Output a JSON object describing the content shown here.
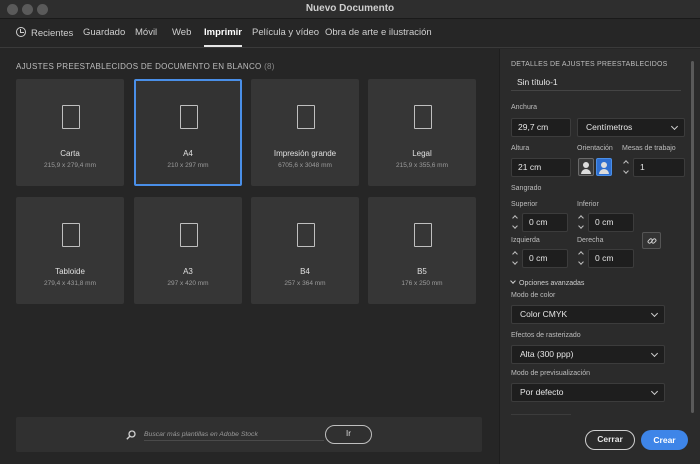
{
  "window": {
    "title": "Nuevo Documento"
  },
  "tabs": [
    {
      "label": "Recientes",
      "icon": "clock-icon"
    },
    {
      "label": "Guardado"
    },
    {
      "label": "Móvil"
    },
    {
      "label": "Web"
    },
    {
      "label": "Imprimir",
      "active": true
    },
    {
      "label": "Película y vídeo"
    },
    {
      "label": "Obra de arte e ilustración"
    }
  ],
  "presets": {
    "title": "AJUSTES PREESTABLECIDOS DE DOCUMENTO EN BLANCO",
    "count": "(8)",
    "items": [
      {
        "name": "Carta",
        "size": "215,9 x 279,4 mm"
      },
      {
        "name": "A4",
        "size": "210 x 297 mm",
        "selected": true
      },
      {
        "name": "Impresión grande",
        "size": "6705,6 x 3048 mm"
      },
      {
        "name": "Legal",
        "size": "215,9 x 355,6 mm"
      },
      {
        "name": "Tabloide",
        "size": "279,4 x 431,8 mm"
      },
      {
        "name": "A3",
        "size": "297 x 420 mm"
      },
      {
        "name": "B4",
        "size": "257 x 364 mm"
      },
      {
        "name": "B5",
        "size": "176 x 250 mm"
      }
    ]
  },
  "search": {
    "placeholder": "Buscar más plantillas en Adobe Stock",
    "go_label": "Ir"
  },
  "details": {
    "heading": "DETALLES DE AJUSTES PREESTABLECIDOS",
    "doc_name": "Sin título-1",
    "width_label": "Anchura",
    "width_value": "29,7 cm",
    "units_value": "Centímetros",
    "height_label": "Altura",
    "height_value": "21 cm",
    "orientation_label": "Orientación",
    "artboards_label": "Mesas de trabajo",
    "artboards_value": "1",
    "bleed_label": "Sangrado",
    "top_label": "Superior",
    "top_value": "0 cm",
    "bottom_label": "Inferior",
    "bottom_value": "0 cm",
    "left_label": "Izquierda",
    "left_value": "0 cm",
    "right_label": "Derecha",
    "right_value": "0 cm",
    "advanced_label": "Opciones avanzadas",
    "color_mode_label": "Modo de color",
    "color_mode_value": "Color CMYK",
    "raster_label": "Efectos de rasterizado",
    "raster_value": "Alta (300 ppp)",
    "preview_label": "Modo de previsualización",
    "preview_value": "Por defecto"
  },
  "footer": {
    "close_label": "Cerrar",
    "create_label": "Crear"
  },
  "colors": {
    "accent": "#3e85e8",
    "selected_border": "#4a8fe8",
    "card_bg": "#363636",
    "panel_bg": "#2b2b2b"
  }
}
